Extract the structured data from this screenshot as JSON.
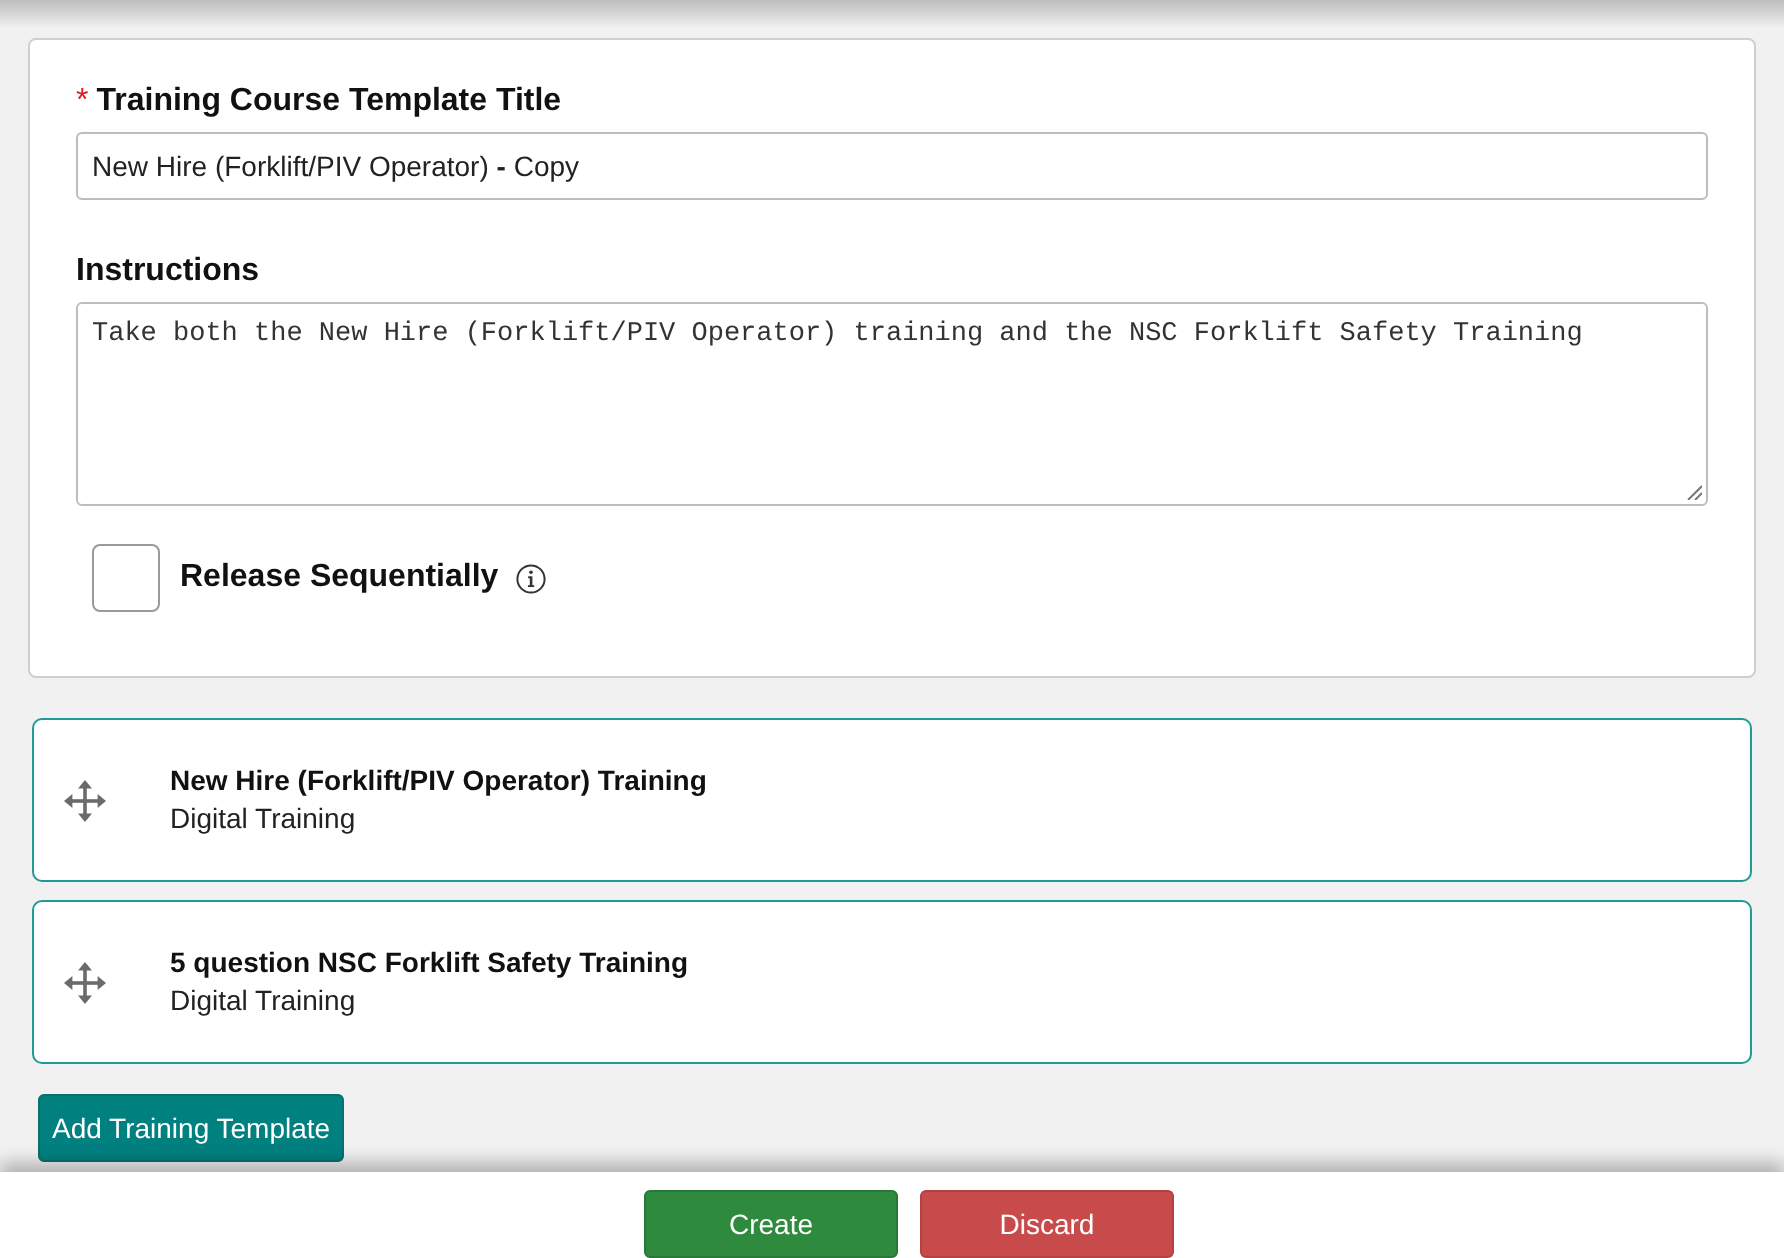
{
  "form": {
    "title_field": {
      "required_mark": "*",
      "label": "Training Course Template Title",
      "value": "New Hire (Forklift/PIV Operator) **-** Copy"
    },
    "instructions_field": {
      "label": "Instructions",
      "value": "Take both the New Hire (Forklift/PIV Operator) training and the NSC Forklift Safety Training"
    },
    "release_sequentially": {
      "label": "Release Sequentially",
      "checked": false
    }
  },
  "training_templates": [
    {
      "title": "New Hire (Forklift/PIV Operator) Training",
      "type": "Digital Training"
    },
    {
      "title": "5 question NSC Forklift Safety Training",
      "type": "Digital Training"
    }
  ],
  "add_button": "Add Training Template",
  "actions": [
    {
      "label": "Create",
      "kind": "primary"
    },
    {
      "label": "Discard",
      "kind": "danger"
    }
  ]
}
